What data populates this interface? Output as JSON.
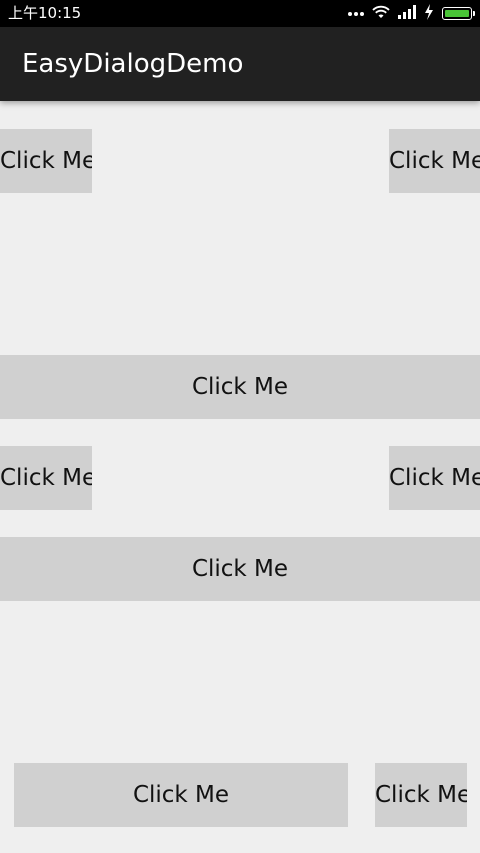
{
  "status_bar": {
    "time": "上午10:15",
    "battery_color": "#49c437"
  },
  "app_bar": {
    "title": "EasyDialogDemo"
  },
  "buttons": {
    "top_left": "Click Me",
    "top_right": "Click Me",
    "middle_wide_1": "Click Me",
    "middle_left": "Click Me",
    "middle_right": "Click Me",
    "middle_wide_2": "Click Me",
    "bottom_wide": "Click Me",
    "bottom_right": "Click Me"
  },
  "colors": {
    "background": "#efefef",
    "button": "#d0d0d0",
    "app_bar": "#212121"
  }
}
